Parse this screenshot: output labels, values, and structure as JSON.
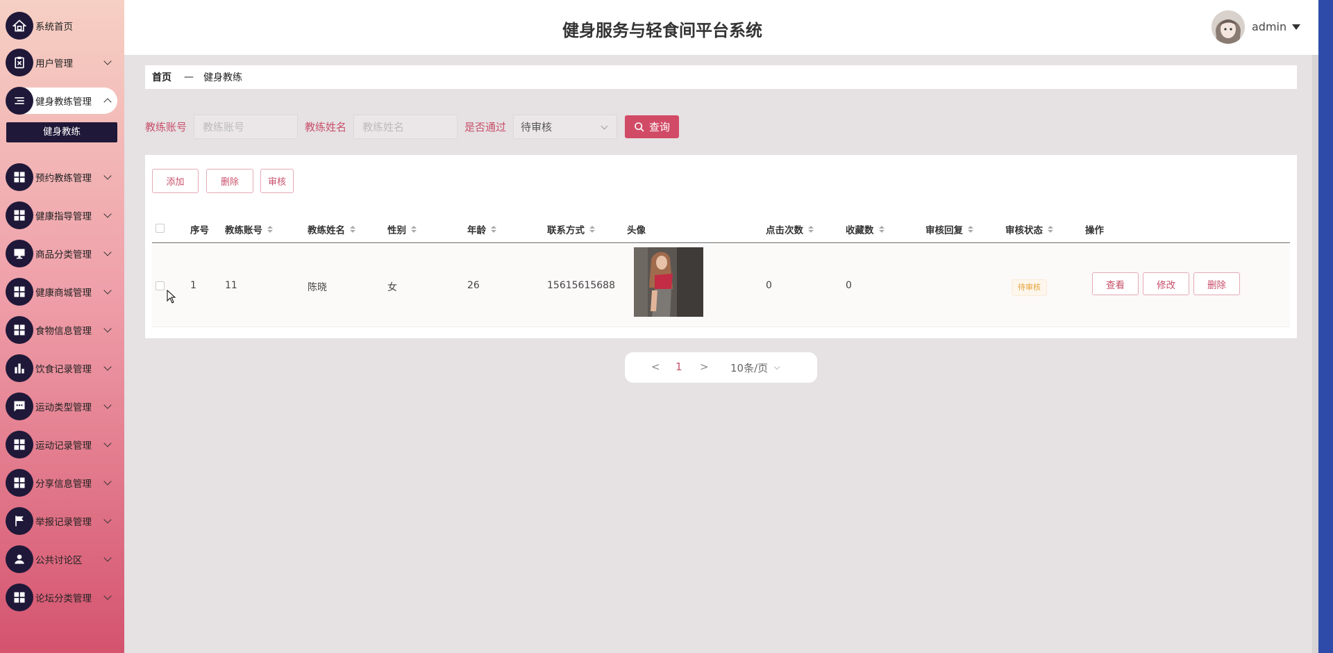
{
  "app_title": "健身服务与轻食间平台系统",
  "user": {
    "name": "admin"
  },
  "sidebar": {
    "items": [
      {
        "label": "系统首页",
        "icon": "home-icon"
      },
      {
        "label": "用户管理",
        "icon": "clipboard-icon"
      },
      {
        "label": "健身教练管理",
        "icon": "list-icon",
        "expanded": true
      },
      {
        "label": "预约教练管理",
        "icon": "grid-icon"
      },
      {
        "label": "健康指导管理",
        "icon": "grid-icon"
      },
      {
        "label": "商品分类管理",
        "icon": "monitor-icon"
      },
      {
        "label": "健康商城管理",
        "icon": "grid-icon"
      },
      {
        "label": "食物信息管理",
        "icon": "grid-icon"
      },
      {
        "label": "饮食记录管理",
        "icon": "bar-chart-icon"
      },
      {
        "label": "运动类型管理",
        "icon": "chat-icon"
      },
      {
        "label": "运动记录管理",
        "icon": "grid-icon"
      },
      {
        "label": "分享信息管理",
        "icon": "grid-icon"
      },
      {
        "label": "举报记录管理",
        "icon": "flag-icon"
      },
      {
        "label": "公共讨论区",
        "icon": "person-icon"
      },
      {
        "label": "论坛分类管理",
        "icon": "grid-icon"
      }
    ],
    "subitem": "健身教练"
  },
  "breadcrumb": {
    "home": "首页",
    "separator": "—",
    "current": "健身教练"
  },
  "search": {
    "account_label": "教练账号",
    "account_placeholder": "教练账号",
    "name_label": "教练姓名",
    "name_placeholder": "教练姓名",
    "pass_label": "是否通过",
    "pass_value": "待审核",
    "query_button": "查询"
  },
  "actions": {
    "add": "添加",
    "delete": "删除",
    "review": "审核"
  },
  "table": {
    "columns": [
      "序号",
      "教练账号",
      "教练姓名",
      "性别",
      "年龄",
      "联系方式",
      "头像",
      "点击次数",
      "收藏数",
      "审核回复",
      "审核状态",
      "操作"
    ],
    "rows": [
      {
        "index": "1",
        "account": "11",
        "name": "陈晓",
        "gender": "女",
        "age": "26",
        "phone": "15615615688",
        "clicks": "0",
        "favorites": "0",
        "reply": "",
        "status": "待审核",
        "ops": {
          "view": "查看",
          "edit": "修改",
          "delete": "删除"
        }
      }
    ]
  },
  "pagination": {
    "prev": "<",
    "page": "1",
    "next": ">",
    "page_size": "10条/页"
  },
  "colors": {
    "accent": "#d14a66",
    "sidebar_dark": "#1f1838",
    "badge_text": "#e6a23c"
  }
}
